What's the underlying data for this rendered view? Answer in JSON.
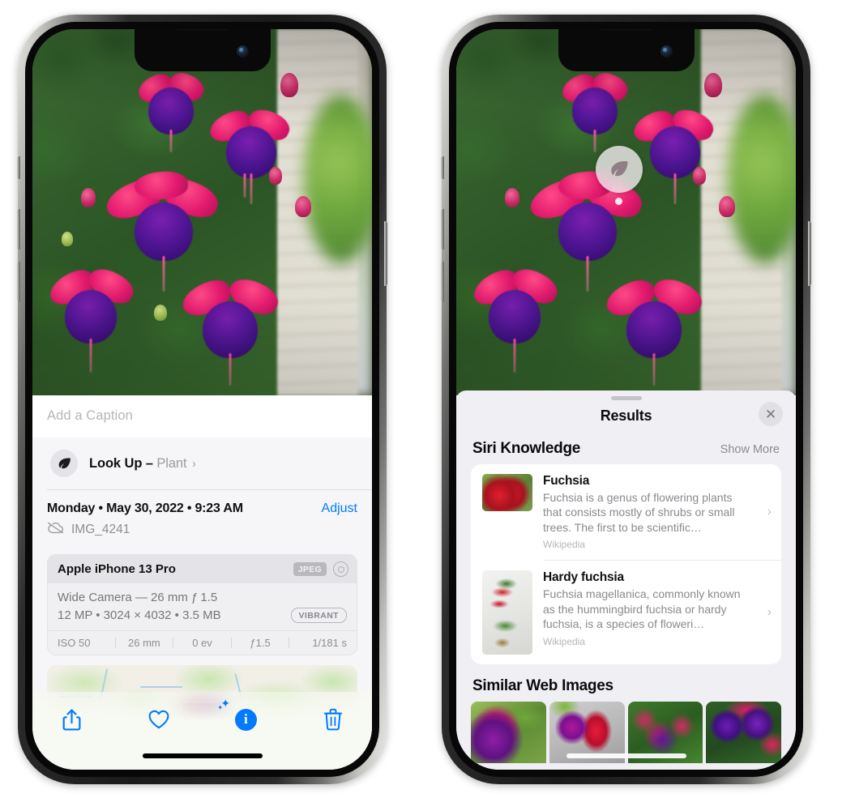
{
  "left_phone": {
    "caption": {
      "placeholder": "Add a Caption",
      "value": ""
    },
    "look_up": {
      "label": "Look Up",
      "dash": "–",
      "subject": "Plant",
      "chevron": "›",
      "icon": "leaf-icon"
    },
    "metadata": {
      "date_line": "Monday • May 30, 2022 • 9:23 AM",
      "adjust_label": "Adjust",
      "filename": "IMG_4241",
      "cloud_icon": "icloud-slash-icon"
    },
    "exif": {
      "device": "Apple iPhone 13 Pro",
      "format_badge": "JPEG",
      "hdr_icon": "hdr-circles-icon",
      "lens_line": "Wide Camera — 26 mm ƒ 1.5",
      "size_line": "12 MP • 3024 × 4032 • 3.5 MB",
      "style_badge": "VIBRANT",
      "shot": [
        "ISO 50",
        "26 mm",
        "0 ev",
        "ƒ1.5",
        "1/181 s"
      ]
    },
    "map": {
      "pin": "photo-thumbnail-pin"
    },
    "toolbar": [
      {
        "name": "share-button",
        "icon": "share-icon"
      },
      {
        "name": "favorite-button",
        "icon": "heart-icon"
      },
      {
        "name": "info-button",
        "icon": "info-sparkle-icon"
      },
      {
        "name": "delete-button",
        "icon": "trash-icon"
      }
    ]
  },
  "right_phone": {
    "vlu_badge": {
      "icon": "leaf-icon"
    },
    "sheet": {
      "grabber": "drag-handle",
      "title": "Results",
      "close_label": "✕"
    },
    "siri_knowledge": {
      "heading": "Siri Knowledge",
      "show_more": "Show More",
      "items": [
        {
          "title": "Fuchsia",
          "desc": "Fuchsia is a genus of flowering plants that consists mostly of shrubs or small trees. The first to be scientific…",
          "source": "Wikipedia",
          "chevron": "›"
        },
        {
          "title": "Hardy fuchsia",
          "desc": "Fuchsia magellanica, commonly known as the hummingbird fuchsia or hardy fuchsia, is a species of floweri…",
          "source": "Wikipedia",
          "chevron": "›"
        }
      ]
    },
    "similar_web_images": {
      "heading": "Similar Web Images",
      "count": 4
    }
  },
  "colors": {
    "accent_blue": "#007AFF",
    "sheet_gray": "#F6F6F8",
    "results_gray": "#F0EFF4",
    "card_white": "#FFFFFF",
    "secondary_text": "#8E8E93"
  }
}
